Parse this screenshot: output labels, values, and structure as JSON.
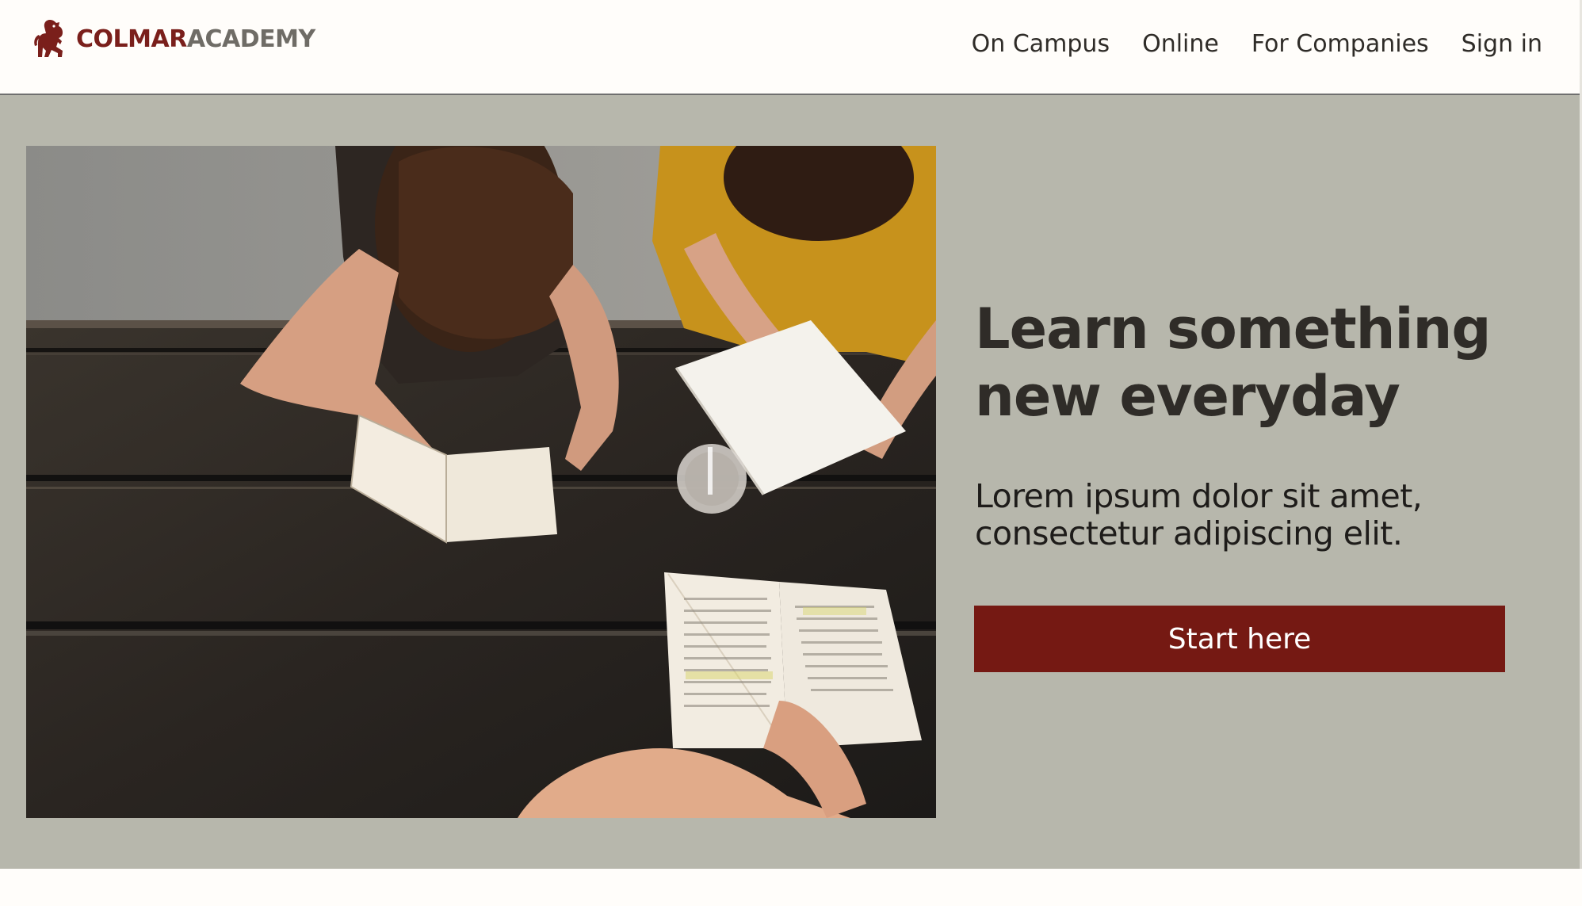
{
  "header": {
    "logo": {
      "brand_primary": "COLMAR",
      "brand_secondary": "ACADEMY",
      "icon": "lion-crest-icon"
    },
    "nav": [
      {
        "label": "On Campus"
      },
      {
        "label": "Online"
      },
      {
        "label": "For Companies"
      },
      {
        "label": "Sign in"
      }
    ]
  },
  "hero": {
    "image": {
      "alt": "",
      "subject": "students-reading-at-table-photo"
    },
    "title_line1": "Learn something",
    "title_line2": "new everyday",
    "subtitle_line1": "Lorem ipsum dolor sit amet,",
    "subtitle_line2": "consectetur adipiscing elit.",
    "cta_label": "Start here"
  },
  "colors": {
    "brand_red": "#751913",
    "hero_background": "#B7B7AC",
    "page_background": "#FFFDFA",
    "text_dark": "#2F2C28"
  }
}
